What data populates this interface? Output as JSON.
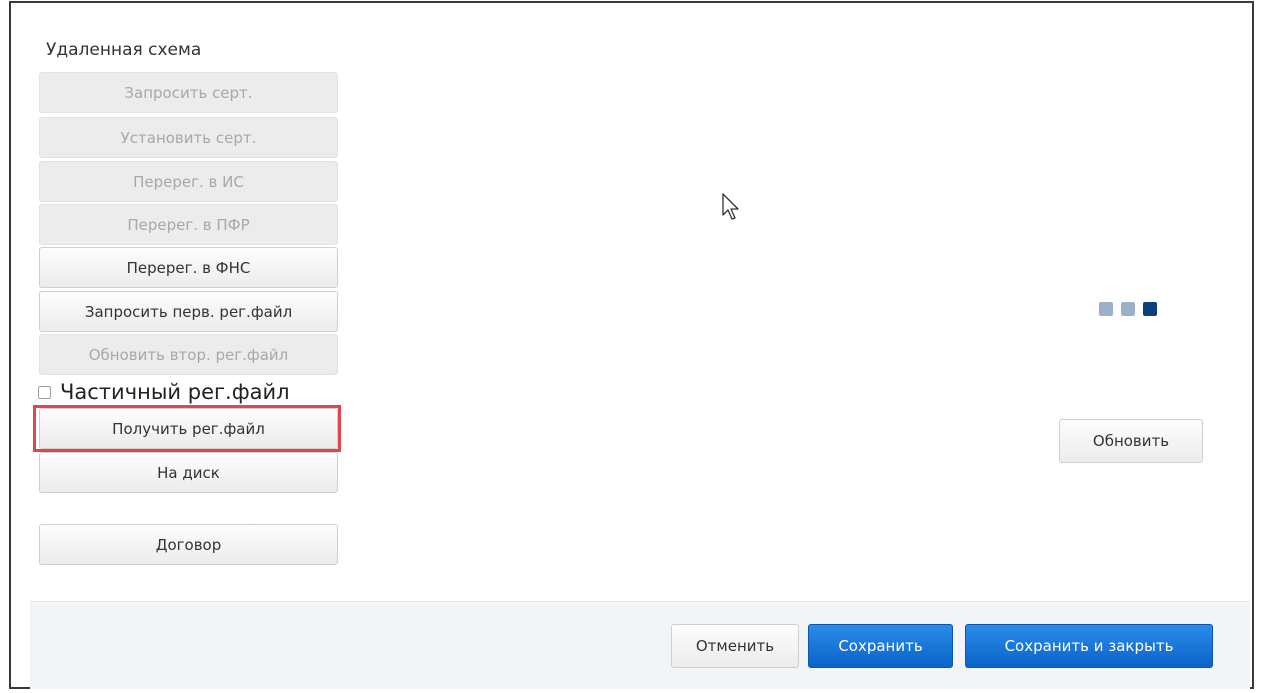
{
  "section_title": "Удаленная схема",
  "left_buttons": [
    {
      "label": "Запросить серт.",
      "enabled": false
    },
    {
      "label": "Установить серт.",
      "enabled": false
    },
    {
      "label": "Перерег. в ИС",
      "enabled": false
    },
    {
      "label": "Перерег. в ПФР",
      "enabled": false
    },
    {
      "label": "Перерег. в ФНС",
      "enabled": true
    },
    {
      "label": "Запросить перв. рег.файл",
      "enabled": true
    },
    {
      "label": "Обновить втор. рег.файл",
      "enabled": false
    }
  ],
  "partial_checkbox": {
    "label": "Частичный рег.файл",
    "checked": false
  },
  "get_regfile_label": "Получить рег.файл",
  "to_disk_label": "На диск",
  "contract_label": "Договор",
  "refresh_label": "Обновить",
  "loading_dots": {
    "count": 3,
    "active_index": 2,
    "colors": {
      "inactive": "#9bb0c9",
      "active": "#0d3f7e"
    }
  },
  "highlight_color": "#e0464b",
  "footer": {
    "cancel_label": "Отменить",
    "save_label": "Сохранить",
    "save_close_label": "Сохранить и закрыть"
  },
  "colors": {
    "primary": "#0b63c9",
    "disabled_text": "#a8a8a8"
  }
}
